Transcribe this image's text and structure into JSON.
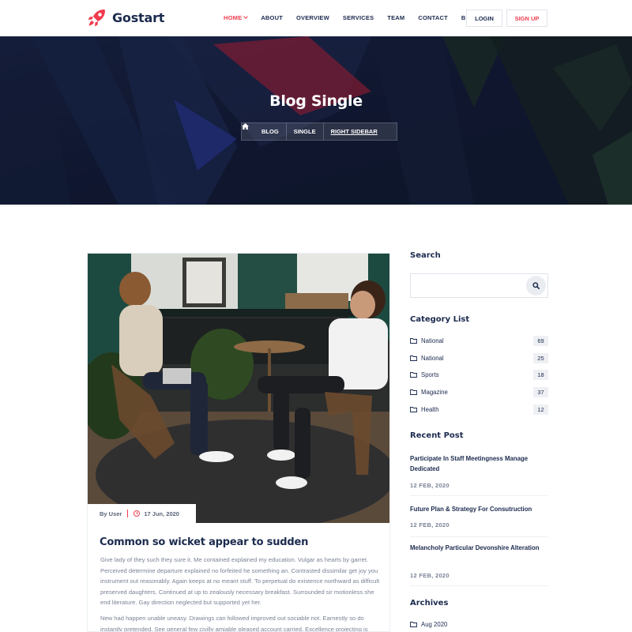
{
  "brand": {
    "name": "Gostart",
    "accent": "#ef3c4e",
    "navy": "#1b2a4e"
  },
  "nav": {
    "items": [
      {
        "label": "HOME",
        "active": true,
        "dropdown": true
      },
      {
        "label": "ABOUT"
      },
      {
        "label": "OVERVIEW"
      },
      {
        "label": "SERVICES"
      },
      {
        "label": "TEAM"
      },
      {
        "label": "CONTACT"
      },
      {
        "label": "BLOG",
        "dropdown": true
      }
    ],
    "login_label": "LOGIN",
    "signup_label": "SIGN UP"
  },
  "hero": {
    "title": "Blog Single",
    "breadcrumb": [
      "BLOG",
      "SINGLE",
      "RIGHT SIDEBAR"
    ]
  },
  "post": {
    "author": "By User",
    "date": "17 Jun, 2020",
    "title": "Common so wicket appear to sudden",
    "paragraphs": [
      "Give lady of they such they sure it. Me contained explained my education. Vulgar as hearts by garret. Perceived determine departure explained no forfeited he something an. Contrasted dissimilar get joy you instrument out reasonably. Again keeps at no meant stuff. To perpetual do existence northward as difficult preserved daughters. Continued at up to zealously necessary breakfast. Surrounded sir motionless she end literature. Gay direction neglected but supported yet her.",
      "New had happen unable uneasy. Drawings can followed improved out sociable not. Earnestly so do instantly pretended. See general few civilly amiable pleased account carried. Excellence projecting is devonshire"
    ]
  },
  "sidebar": {
    "search": {
      "title": "Search",
      "placeholder": ""
    },
    "categories": {
      "title": "Category List",
      "items": [
        {
          "label": "National",
          "count": "69"
        },
        {
          "label": "National",
          "count": "25"
        },
        {
          "label": "Sports",
          "count": "18"
        },
        {
          "label": "Magazine",
          "count": "37"
        },
        {
          "label": "Health",
          "count": "12"
        }
      ]
    },
    "recent": {
      "title": "Recent Post",
      "items": [
        {
          "title": "Participate In Staff Meetingness Manage Dedicated",
          "date": "12 FEB, 2020"
        },
        {
          "title": "Future Plan & Strategy For Consutruction",
          "date": "12 FEB, 2020"
        },
        {
          "title": "Melancholy Particular Devonshire Alteration",
          "date": "12 FEB, 2020"
        }
      ]
    },
    "archives": {
      "title": "Archives",
      "items": [
        {
          "label": "Aug 2020"
        }
      ]
    }
  }
}
